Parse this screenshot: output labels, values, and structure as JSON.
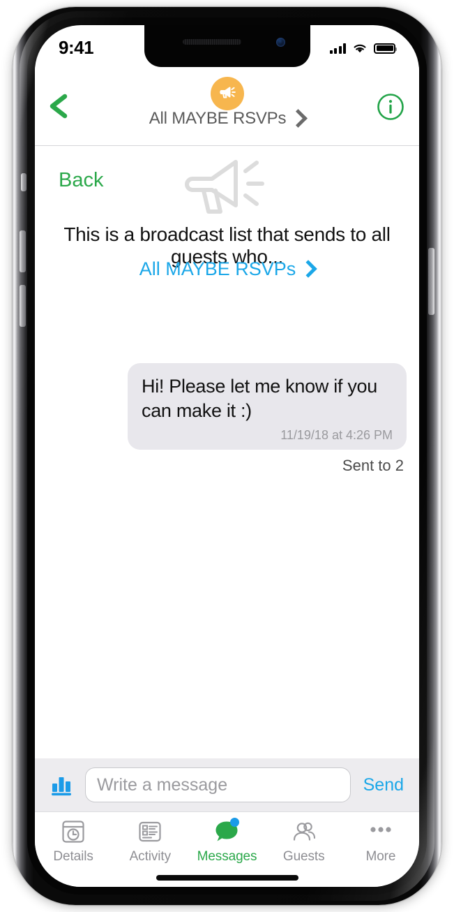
{
  "status_bar": {
    "time": "9:41",
    "signal_icon": "cellular-signal-icon",
    "wifi_icon": "wifi-icon",
    "battery_icon": "battery-icon"
  },
  "nav_bar": {
    "back_icon": "chevron-left-icon",
    "avatar_icon": "megaphone-icon",
    "title": "All MAYBE RSVPs",
    "title_chevron_icon": "chevron-right-icon",
    "info_icon": "info-circle-icon",
    "accent_green": "#2BA84A",
    "avatar_bg": "#F7B64E",
    "title_color": "#5a5a5a"
  },
  "content": {
    "back_label": "Back",
    "hero_icon": "megaphone-outline-icon",
    "description": "This is a broadcast list that sends to all guests who...",
    "recipient_link": "All MAYBE RSVPs",
    "recipient_chevron_icon": "chevron-right-icon",
    "link_color": "#1BA7E8"
  },
  "message": {
    "text": "Hi! Please let me know if you can make it :)",
    "timestamp": "11/19/18 at 4:26 PM",
    "status": "Sent to 2",
    "bubble_color": "#E8E7EC"
  },
  "input_bar": {
    "poll_icon": "bar-chart-icon",
    "placeholder": "Write a message",
    "value": "",
    "send_label": "Send",
    "send_color": "#1BA7E8",
    "background": "#EDECEF"
  },
  "tab_bar": {
    "items": [
      {
        "label": "Details",
        "icon": "calendar-clock-icon",
        "active": false,
        "badge": false
      },
      {
        "label": "Activity",
        "icon": "feed-list-icon",
        "active": false,
        "badge": false
      },
      {
        "label": "Messages",
        "icon": "speech-bubble-icon",
        "active": true,
        "badge": true
      },
      {
        "label": "Guests",
        "icon": "people-group-icon",
        "active": false,
        "badge": false
      },
      {
        "label": "More",
        "icon": "ellipsis-icon",
        "active": false,
        "badge": false
      }
    ],
    "active_color": "#2BA84A",
    "inactive_color": "#8e8e93",
    "badge_color": "#1B9BE8"
  }
}
